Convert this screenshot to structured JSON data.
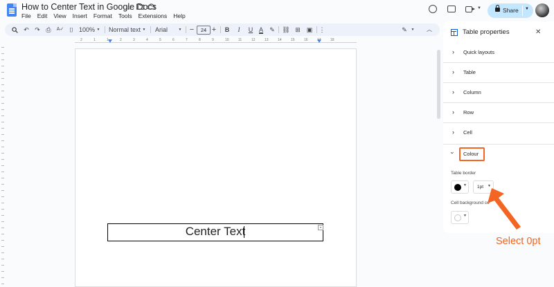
{
  "app": {
    "doc_title": "How to Center Text in Google Docs",
    "menu": [
      "File",
      "Edit",
      "View",
      "Insert",
      "Format",
      "Tools",
      "Extensions",
      "Help"
    ],
    "share_label": "Share"
  },
  "toolbar": {
    "zoom": "100%",
    "style": "Normal text",
    "font": "Arial",
    "font_size": "24",
    "minus": "−",
    "plus": "+"
  },
  "ruler": {
    "numbers": [
      "2",
      "1",
      "1",
      "2",
      "3",
      "4",
      "5",
      "6",
      "7",
      "8",
      "9",
      "10",
      "11",
      "12",
      "13",
      "14",
      "15",
      "16",
      "17",
      "18"
    ]
  },
  "document": {
    "cell_text": "Center Text"
  },
  "panel": {
    "title": "Table properties",
    "sections": [
      "Quick layouts",
      "Table",
      "Column",
      "Row",
      "Cell"
    ],
    "colour_label": "Colour",
    "table_border_label": "Table border",
    "border_width": "1pt",
    "cell_bg_label": "Cell background co",
    "border_color": "#000000",
    "cell_bg_color": "#ffffff"
  },
  "annotation": {
    "text": "Select 0pt",
    "color": "#f26522"
  },
  "icons": [
    "doc-icon",
    "star-icon",
    "folder-icon",
    "cloud-icon",
    "history-icon",
    "comment-icon",
    "meet-icon",
    "lock-icon",
    "search-icon",
    "undo-icon",
    "redo-icon",
    "print-icon",
    "spellcheck-icon",
    "paint-format-icon",
    "bold-icon",
    "italic-icon",
    "underline-icon",
    "text-color-icon",
    "highlight-icon",
    "link-icon",
    "add-comment-icon",
    "image-icon",
    "more-icon",
    "edit-mode-icon",
    "collapse-icon",
    "table-icon",
    "close-icon"
  ]
}
